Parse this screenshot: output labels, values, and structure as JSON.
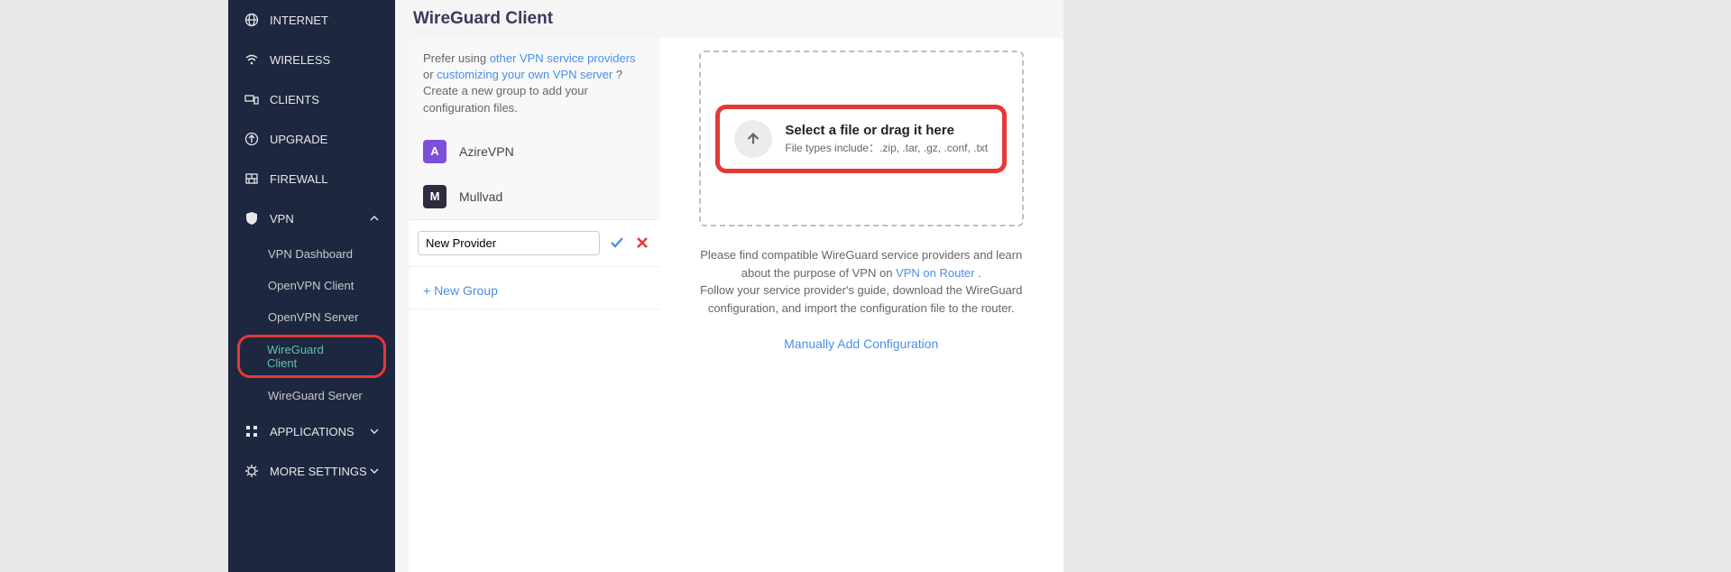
{
  "page": {
    "title": "WireGuard Client"
  },
  "sidebar": {
    "items": [
      {
        "label": "INTERNET",
        "icon": "globe"
      },
      {
        "label": "WIRELESS",
        "icon": "wifi"
      },
      {
        "label": "CLIENTS",
        "icon": "devices"
      },
      {
        "label": "UPGRADE",
        "icon": "upgrade"
      },
      {
        "label": "FIREWALL",
        "icon": "firewall"
      },
      {
        "label": "VPN",
        "icon": "shield",
        "expanded": true
      },
      {
        "label": "APPLICATIONS",
        "icon": "apps",
        "chevron": true
      },
      {
        "label": "MORE SETTINGS",
        "icon": "gear",
        "chevron": true
      }
    ],
    "vpnSubitems": [
      {
        "label": "VPN Dashboard"
      },
      {
        "label": "OpenVPN Client"
      },
      {
        "label": "OpenVPN Server"
      },
      {
        "label": "WireGuard Client",
        "active": true
      },
      {
        "label": "WireGuard Server"
      }
    ]
  },
  "leftPanel": {
    "prefer_text_1": "Prefer using ",
    "prefer_link_1": "other VPN service providers",
    "prefer_text_2": " or ",
    "prefer_link_2": "customizing your own VPN server",
    "prefer_text_3": " ? Create a new group to add your configuration files.",
    "providers": [
      {
        "initial": "A",
        "name": "AzireVPN",
        "colorClass": "purple"
      },
      {
        "initial": "M",
        "name": "Mullvad",
        "colorClass": "dark"
      }
    ],
    "newProviderValue": "New Provider",
    "newGroupLabel": "+ New Group"
  },
  "rightPanel": {
    "dropTitle": "Select a file or drag it here",
    "dropSub": "File types include：.zip, .tar, .gz, .conf, .txt",
    "info_1": "Please find compatible WireGuard service providers and learn about the purpose of VPN on ",
    "info_link_1": "VPN on Router ",
    "info_2": ".",
    "info_3": "Follow your service provider's guide, download the WireGuard configuration, and import the configuration file to the router.",
    "manualLink": "Manually Add Configuration"
  }
}
